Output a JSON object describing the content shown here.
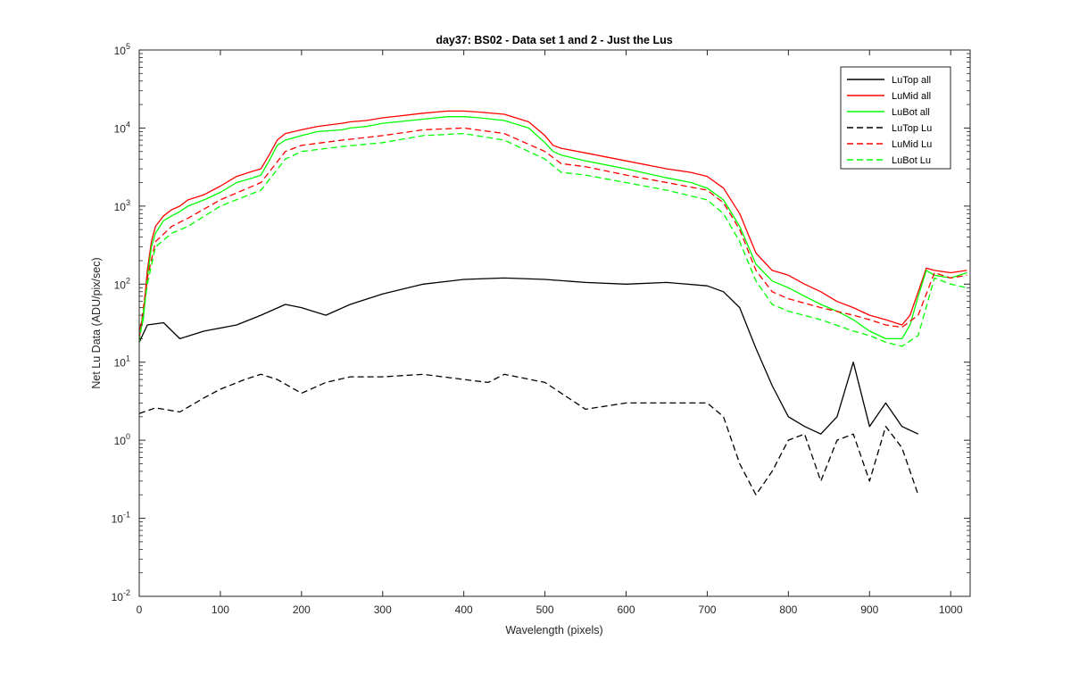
{
  "chart_data": {
    "type": "line",
    "title": "day37: BS02 - Data set 1 and 2 - Just the Lus",
    "xlabel": "Wavelength (pixels)",
    "ylabel": "Net Lu Data (ADU/pix/sec)",
    "xlim": [
      0,
      1024
    ],
    "ylim": [
      0.01,
      100000
    ],
    "yscale": "log",
    "grid": false,
    "legend_position": "top-right",
    "x_ticks": [
      0,
      100,
      200,
      300,
      400,
      500,
      600,
      700,
      800,
      900,
      1000
    ],
    "x_tick_labels": [
      "0",
      "100",
      "200",
      "300",
      "400",
      "500",
      "600",
      "700",
      "800",
      "900",
      "1000"
    ],
    "y_tick_exponents": [
      -2,
      -1,
      0,
      1,
      2,
      3,
      4,
      5
    ],
    "series": [
      {
        "name": "LuTop  all",
        "color": "#000000",
        "dash": "solid",
        "x": [
          0,
          10,
          30,
          50,
          80,
          120,
          150,
          180,
          200,
          230,
          260,
          300,
          350,
          400,
          450,
          500,
          550,
          600,
          650,
          700,
          720,
          740,
          760,
          780,
          800,
          820,
          840,
          860,
          880,
          900,
          920,
          940,
          960
        ],
        "y": [
          18,
          30,
          32,
          20,
          25,
          30,
          40,
          55,
          50,
          40,
          55,
          75,
          100,
          115,
          120,
          115,
          105,
          100,
          105,
          95,
          80,
          50,
          15,
          5,
          2,
          1.5,
          1.2,
          2,
          10,
          1.5,
          3,
          1.5,
          1.2
        ]
      },
      {
        "name": "LuMid  all",
        "color": "#ff0000",
        "dash": "solid",
        "x": [
          0,
          5,
          10,
          15,
          20,
          30,
          40,
          50,
          60,
          80,
          100,
          120,
          140,
          150,
          160,
          170,
          180,
          200,
          220,
          250,
          260,
          280,
          300,
          350,
          380,
          400,
          420,
          450,
          480,
          500,
          510,
          520,
          550,
          600,
          650,
          680,
          700,
          720,
          740,
          760,
          780,
          800,
          820,
          840,
          860,
          880,
          900,
          920,
          940,
          950,
          960,
          970,
          980,
          1000,
          1020
        ],
        "y": [
          25,
          40,
          150,
          350,
          550,
          750,
          900,
          1000,
          1200,
          1400,
          1800,
          2400,
          2800,
          3000,
          4500,
          7000,
          8500,
          9500,
          10500,
          11500,
          12000,
          12500,
          13500,
          15500,
          16500,
          16500,
          16000,
          15000,
          12000,
          8000,
          6000,
          5500,
          4800,
          3800,
          3000,
          2700,
          2400,
          1700,
          800,
          250,
          150,
          130,
          100,
          80,
          60,
          50,
          40,
          35,
          30,
          40,
          80,
          160,
          150,
          140,
          150
        ]
      },
      {
        "name": "LuBot  all",
        "color": "#00ff00",
        "dash": "solid",
        "x": [
          0,
          5,
          10,
          15,
          20,
          30,
          40,
          50,
          60,
          80,
          100,
          120,
          140,
          150,
          160,
          170,
          180,
          200,
          220,
          250,
          260,
          280,
          300,
          350,
          380,
          400,
          420,
          450,
          480,
          500,
          510,
          520,
          550,
          600,
          650,
          680,
          700,
          720,
          740,
          760,
          780,
          800,
          820,
          840,
          860,
          880,
          900,
          920,
          940,
          950,
          960,
          970,
          980,
          1000,
          1020
        ],
        "y": [
          22,
          35,
          120,
          300,
          450,
          650,
          750,
          850,
          1000,
          1200,
          1500,
          2000,
          2300,
          2500,
          3800,
          6000,
          7000,
          8000,
          9000,
          9500,
          10000,
          10500,
          11500,
          13000,
          14000,
          14000,
          13500,
          12500,
          10000,
          6500,
          5000,
          4500,
          3800,
          3000,
          2300,
          2000,
          1700,
          1200,
          550,
          180,
          110,
          90,
          70,
          55,
          45,
          35,
          25,
          20,
          20,
          30,
          70,
          150,
          130,
          120,
          140
        ]
      },
      {
        "name": "LuTop  Lu",
        "color": "#000000",
        "dash": "dashed",
        "x": [
          0,
          20,
          50,
          80,
          100,
          130,
          150,
          170,
          200,
          230,
          260,
          300,
          350,
          400,
          430,
          450,
          500,
          550,
          600,
          650,
          700,
          720,
          740,
          760,
          780,
          800,
          820,
          840,
          860,
          880,
          900,
          920,
          940,
          960
        ],
        "y": [
          2.2,
          2.6,
          2.3,
          3.5,
          4.5,
          6,
          7,
          6,
          4,
          5.5,
          6.5,
          6.5,
          7,
          6,
          5.5,
          7,
          5.5,
          2.5,
          3,
          3,
          3,
          2,
          0.5,
          0.2,
          0.4,
          1,
          1.2,
          0.3,
          1,
          1.2,
          0.3,
          1.5,
          0.8,
          0.2
        ]
      },
      {
        "name": "LuMid  Lu",
        "color": "#ff0000",
        "dash": "dashed",
        "x": [
          0,
          10,
          20,
          40,
          60,
          100,
          150,
          180,
          200,
          250,
          300,
          350,
          400,
          450,
          500,
          520,
          550,
          600,
          650,
          700,
          720,
          740,
          760,
          780,
          800,
          840,
          880,
          900,
          920,
          940,
          960,
          980,
          1000,
          1020
        ],
        "y": [
          20,
          120,
          350,
          550,
          700,
          1200,
          2000,
          5000,
          6000,
          7000,
          8000,
          9500,
          10000,
          8500,
          5000,
          3500,
          3200,
          2500,
          2000,
          1600,
          1100,
          500,
          150,
          80,
          65,
          50,
          40,
          35,
          30,
          28,
          40,
          140,
          120,
          130
        ]
      },
      {
        "name": "LuBot  Lu",
        "color": "#00ff00",
        "dash": "dashed",
        "x": [
          0,
          10,
          20,
          40,
          60,
          100,
          150,
          180,
          200,
          250,
          300,
          350,
          400,
          450,
          500,
          520,
          550,
          600,
          650,
          700,
          720,
          740,
          760,
          780,
          800,
          840,
          880,
          900,
          920,
          940,
          960,
          980,
          1000,
          1020
        ],
        "y": [
          18,
          100,
          300,
          450,
          550,
          1000,
          1600,
          4000,
          5000,
          5800,
          6500,
          8000,
          8500,
          7000,
          4000,
          2700,
          2500,
          2000,
          1600,
          1200,
          800,
          350,
          110,
          55,
          45,
          35,
          25,
          22,
          18,
          16,
          22,
          120,
          100,
          90
        ]
      }
    ]
  }
}
